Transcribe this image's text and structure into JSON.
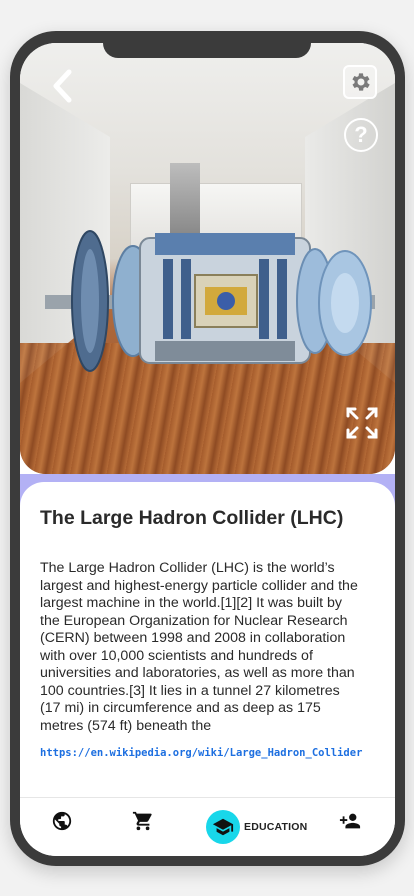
{
  "viewer": {
    "back_icon": "chevron-left-icon",
    "settings_icon": "gear-icon",
    "help_icon": "question-mark-icon",
    "help_symbol": "?",
    "expand_icon": "fullscreen-expand-icon"
  },
  "article": {
    "title": "The Large Hadron Collider (LHC)",
    "body": "The Large Hadron Collider (LHC) is the world’s largest and highest-energy particle collider and the largest machine in the world.[1][2] It was built by the European Organization for Nuclear Research (CERN) between 1998 and 2008 in collaboration with over 10,000 scientists and hundreds of universities and laboratories, as well as more than 100 countries.[3] It lies in a tunnel 27 kilometres (17 mi) in circumference and as deep as 175 metres (574 ft) beneath the",
    "source_link": "https://en.wikipedia.org/wiki/Large_Hadron_Collider"
  },
  "nav": {
    "items": [
      {
        "icon": "globe-icon"
      },
      {
        "icon": "shopping-cart-icon"
      },
      {
        "icon": "graduation-cap-icon",
        "label": "EDUCATION",
        "active": true
      },
      {
        "icon": "add-person-icon"
      }
    ]
  },
  "colors": {
    "accent": "#18d7ea",
    "sheet_edge": "#b3b1f5",
    "link": "#1d6fe0"
  }
}
